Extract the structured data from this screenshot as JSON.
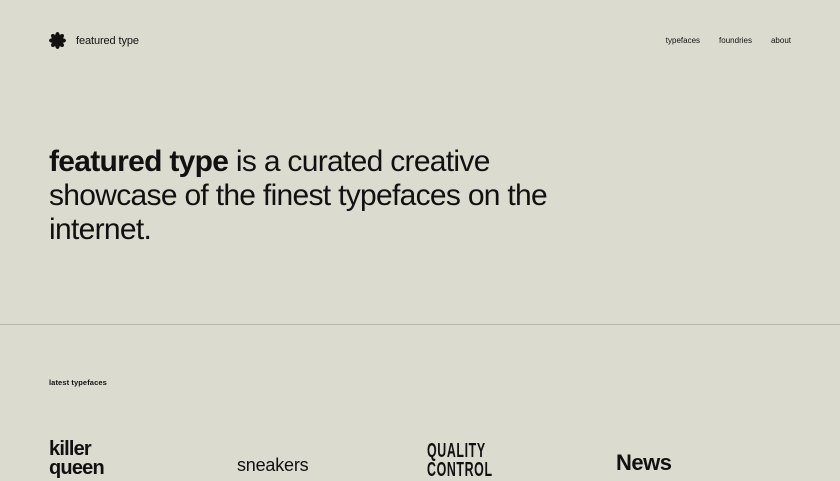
{
  "site": {
    "name": "featured type"
  },
  "nav": {
    "items": [
      "typefaces",
      "foundries",
      "about"
    ]
  },
  "hero": {
    "bold": "featured type",
    "rest": " is a curated creative showcase of the finest typefaces on the internet."
  },
  "latest": {
    "label": "latest typefaces",
    "items": [
      {
        "sample": "killer\nqueen"
      },
      {
        "sample": "sneakers"
      },
      {
        "sample": "QUALITY\nCONTROL"
      },
      {
        "sample": "News"
      }
    ]
  },
  "colors": {
    "background": "#dcdbd0",
    "text": "#111111",
    "divider": "#b7b6ad"
  },
  "icons": {
    "logo": "asterisk-flower-icon"
  }
}
